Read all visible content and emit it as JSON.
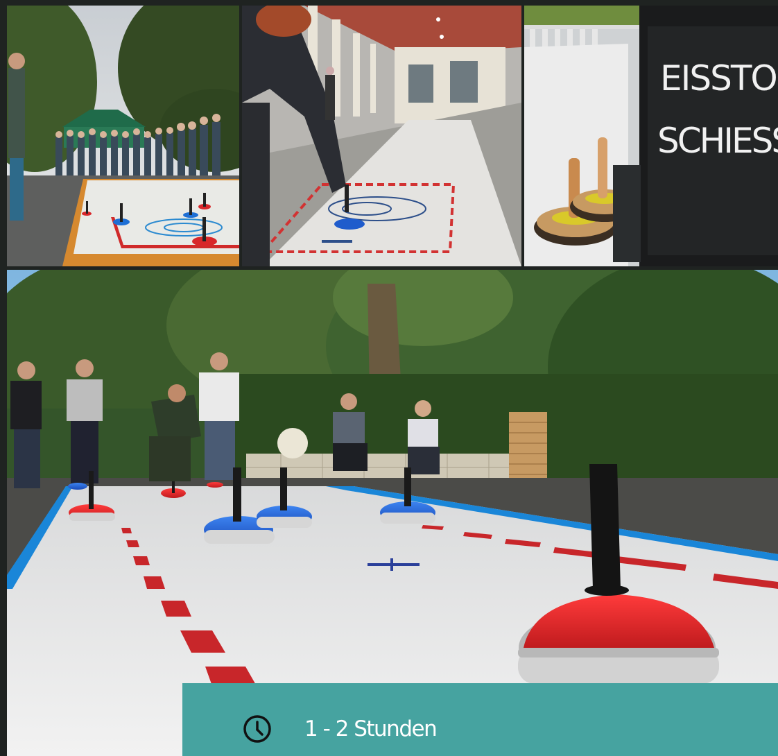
{
  "gallery": {
    "sign_line_1": "EISSTOC",
    "sign_line_2": "SCHIESSE"
  },
  "info": {
    "icon": "clock-icon",
    "duration": "1 - 2 Stunden"
  },
  "colors": {
    "panel": "#46a3a0",
    "stone_red": "#d8272a",
    "stone_blue": "#1f63d6",
    "lane_blue": "#1a86d8",
    "lane_mark_red": "#c8262a"
  }
}
